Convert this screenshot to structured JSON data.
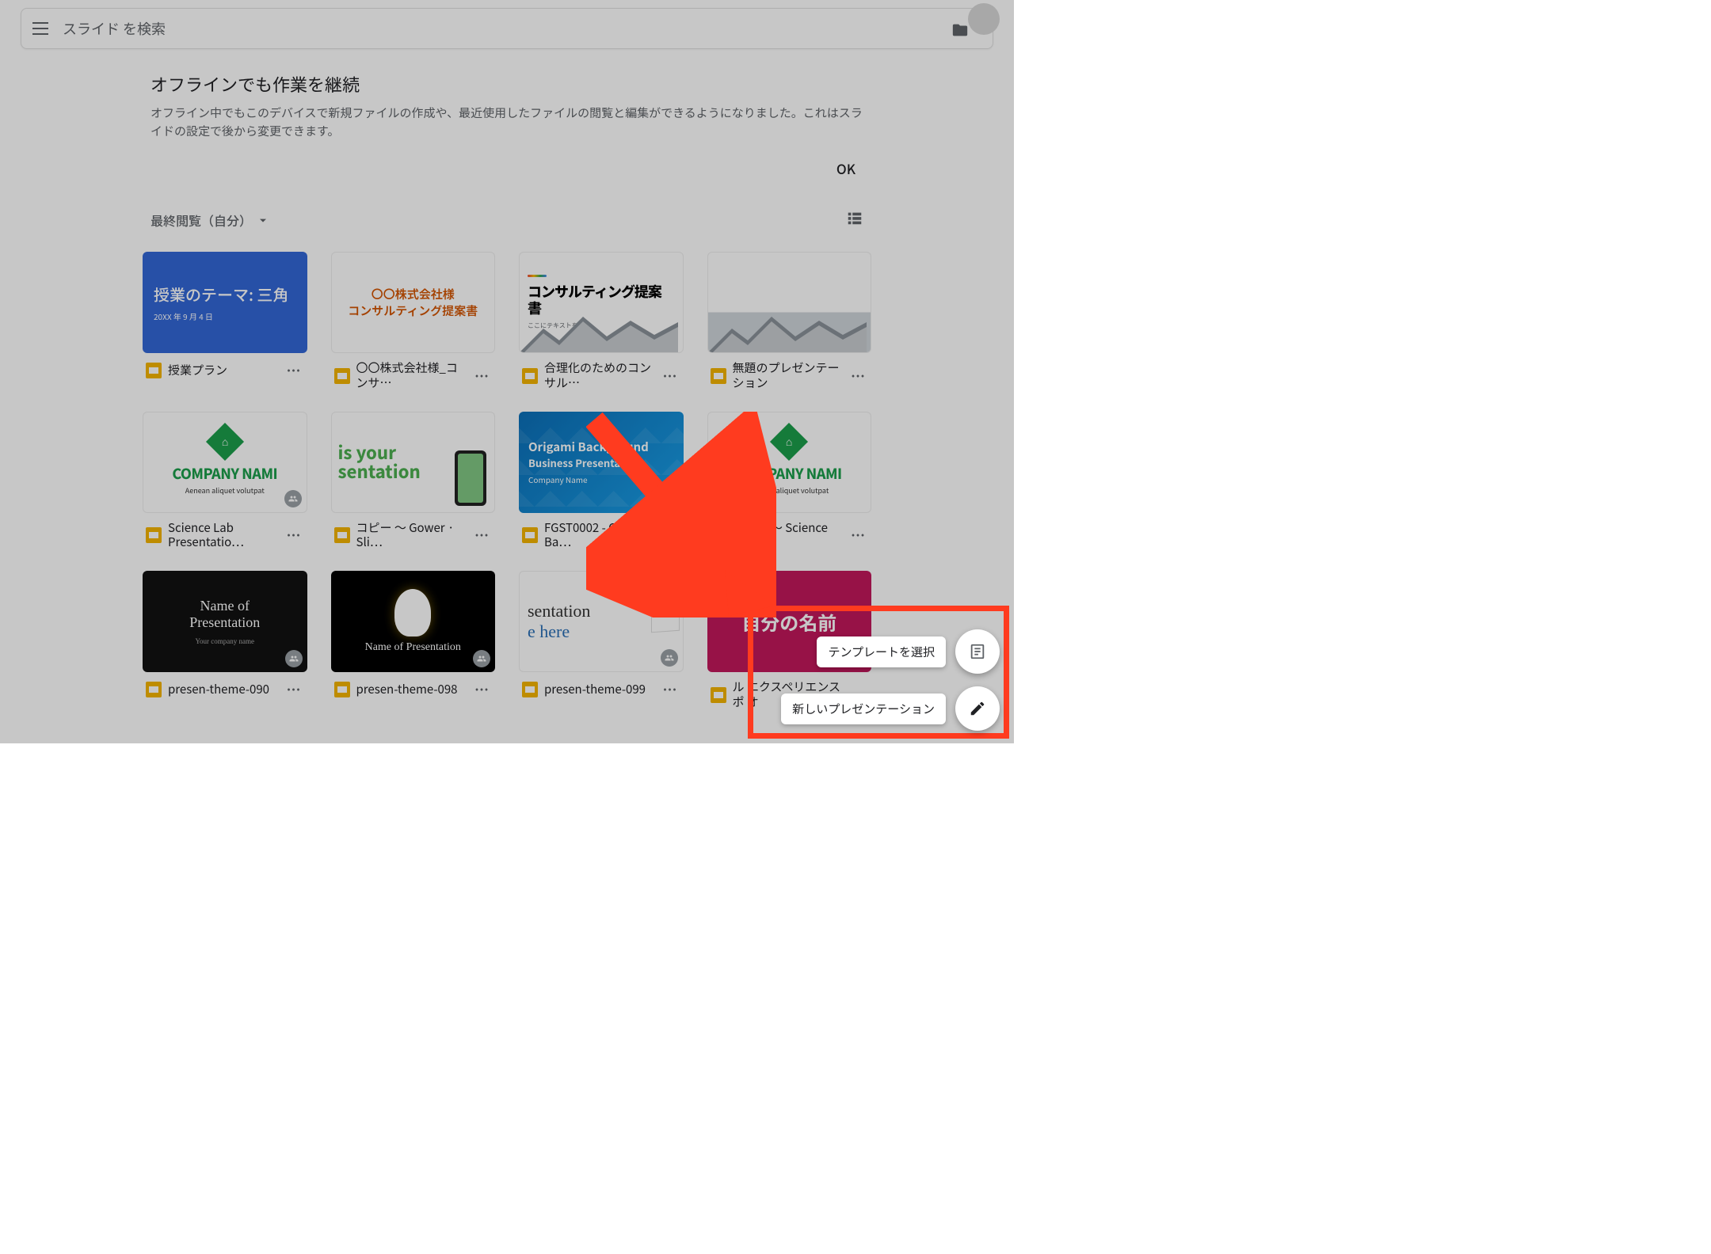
{
  "header": {
    "search_placeholder": "スライド を検索"
  },
  "dialog": {
    "title": "オフラインでも作業を継続",
    "body": "オフライン中でもこのデバイスで新規ファイルの作成や、最近使用したファイルの閲覧と編集ができるようになりました。これはスライドの設定で後から変更できます。",
    "ok": "OK"
  },
  "sort": {
    "label": "最終閲覧（自分）"
  },
  "fab": {
    "template": "テンプレートを選択",
    "new_presentation": "新しいプレゼンテーション"
  },
  "cards": [
    {
      "title": "授業プラン",
      "thumb": {
        "style": "blue",
        "line1": "授業のテーマ: 三角",
        "line2": "20XX 年 9 月 4 日"
      }
    },
    {
      "title": "〇〇株式会社様_コンサ…",
      "thumb": {
        "style": "white",
        "line1": "〇〇株式会社様",
        "line2": "コンサルティング提案書"
      }
    },
    {
      "title": "合理化のためのコンサル…",
      "thumb": {
        "style": "consult",
        "line1": "コンサルティング提案書",
        "line2": "ここにテキストを挿入。"
      }
    },
    {
      "title": "無題のプレゼンテーション",
      "thumb": {
        "style": "mountain"
      }
    },
    {
      "title": "Science Lab Presentatio…",
      "shared": true,
      "thumb": {
        "style": "company",
        "cname": "COMPANY NAMI",
        "ctag": "Aenean aliquet volutpat"
      }
    },
    {
      "title": "コピー ～ Gower · Sli…",
      "thumb": {
        "style": "green",
        "line1": "is your",
        "line2": "sentation"
      }
    },
    {
      "title": "FGST0002 - Origami Ba…",
      "thumb": {
        "style": "origami",
        "line1": "Origami Background",
        "line2": "Business Presentati",
        "line3": "Company Name"
      }
    },
    {
      "title": "コピー ～ Science La…",
      "thumb": {
        "style": "company",
        "cname": "COMPANY NAMI",
        "ctag": "Aenean aliquet volutpat"
      }
    },
    {
      "title": "presen-theme-090",
      "shared": true,
      "thumb": {
        "style": "dark",
        "line1": "Name of",
        "line2": "Presentation",
        "line3": "Your company name"
      }
    },
    {
      "title": "presen-theme-098",
      "shared": true,
      "thumb": {
        "style": "bulb",
        "line1": "Name of Presentation"
      }
    },
    {
      "title": "presen-theme-099",
      "shared": true,
      "thumb": {
        "style": "serif",
        "line1": "sentation",
        "line2": "e here"
      }
    },
    {
      "title": "ル エクスペリエンス ポ オ",
      "thumb": {
        "style": "magenta",
        "line1": "自分の名前"
      }
    }
  ]
}
